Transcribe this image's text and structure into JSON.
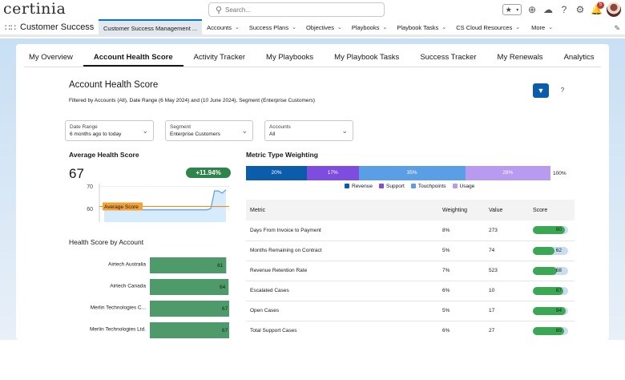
{
  "header": {
    "logo": "certinia",
    "search_placeholder": "Search...",
    "notification_count": "5"
  },
  "nav": {
    "app_name": "Customer Success",
    "items": [
      {
        "label": "Customer Success Management ...",
        "active": true,
        "chevron": false
      },
      {
        "label": "Accounts",
        "chevron": true
      },
      {
        "label": "Success Plans",
        "chevron": true
      },
      {
        "label": "Objectives",
        "chevron": true
      },
      {
        "label": "Playbooks",
        "chevron": true
      },
      {
        "label": "Playbook Tasks",
        "chevron": true
      },
      {
        "label": "CS Cloud Resources",
        "chevron": true
      },
      {
        "label": "More",
        "chevron": true
      }
    ]
  },
  "tabs": [
    {
      "label": "My Overview"
    },
    {
      "label": "Account Health Score",
      "active": true
    },
    {
      "label": "Activity Tracker"
    },
    {
      "label": "My Playbooks"
    },
    {
      "label": "My Playbook Tasks"
    },
    {
      "label": "Success Tracker"
    },
    {
      "label": "My Renewals"
    },
    {
      "label": "Analytics"
    }
  ],
  "page": {
    "title": "Account Health Score",
    "filter_summary": "Filtered by Accounts (All), Date Range (6 May 2024) and (10 June 2024), Segment (Enterprise Customers)",
    "help_label": "?"
  },
  "filters": {
    "date_range": {
      "label": "Date Range",
      "value": "6 months ago to today"
    },
    "segment": {
      "label": "Segment",
      "value": "Enterprise Customers"
    },
    "accounts": {
      "label": "Accounts",
      "value": "All"
    }
  },
  "avg_health": {
    "title": "Average Health Score",
    "value": "67",
    "delta": "+11.94%",
    "avg_label": "Average Score",
    "chart_data": {
      "type": "line",
      "yticks": [
        60,
        70
      ],
      "ylim": [
        54,
        72
      ],
      "average": 61,
      "values": [
        62,
        61,
        59.5,
        59.5,
        59.5,
        59.5,
        59.5,
        59.5,
        59.5,
        59.5,
        59.5,
        59.5,
        59.5,
        59.5,
        59.5,
        59.5,
        59.5,
        59.5,
        59.5,
        59.5,
        59.5,
        59.5,
        59.5,
        59.5,
        59.5,
        59.5,
        59.5,
        59.5,
        60,
        68,
        68,
        67,
        68.5
      ]
    }
  },
  "by_account": {
    "title": "Health Score by Account",
    "chart_data": {
      "type": "bar",
      "categories": [
        "Airtech Australia",
        "Airtech Canada",
        "Merlin Technologies C...",
        "Merlin Technologies Ltd."
      ],
      "values": [
        61,
        64,
        67,
        67
      ],
      "xlim": [
        0,
        90
      ]
    }
  },
  "weighting": {
    "title": "Metric Type Weighting",
    "total_label": "100%",
    "chart_data": {
      "type": "bar",
      "stacked": true,
      "series": [
        {
          "name": "Revenue",
          "value": 20,
          "label": "20%",
          "color": "#0b5cab"
        },
        {
          "name": "Support",
          "value": 17,
          "label": "17%",
          "color": "#7f4ce0"
        },
        {
          "name": "Touchpoints",
          "value": 35,
          "label": "35%",
          "color": "#5a9ee6"
        },
        {
          "name": "Usage",
          "value": 28,
          "label": "28%",
          "color": "#b89af0"
        }
      ]
    }
  },
  "metrics": {
    "columns": [
      "Metric",
      "Weighting",
      "Value",
      "Score"
    ],
    "rows": [
      {
        "metric": "Days From Invoice to Payment",
        "weighting": "8%",
        "value": "273",
        "score": 90
      },
      {
        "metric": "Months Remaining on Contract",
        "weighting": "5%",
        "value": "74",
        "score": 62
      },
      {
        "metric": "Revenue Retention Rate",
        "weighting": "7%",
        "value": "523",
        "score": 68
      },
      {
        "metric": "Escalated Cases",
        "weighting": "6%",
        "value": "10",
        "score": 87
      },
      {
        "metric": "Open Cases",
        "weighting": "5%",
        "value": "17",
        "score": 94
      },
      {
        "metric": "Total Support Cases",
        "weighting": "6%",
        "value": "27",
        "score": 89
      }
    ]
  }
}
